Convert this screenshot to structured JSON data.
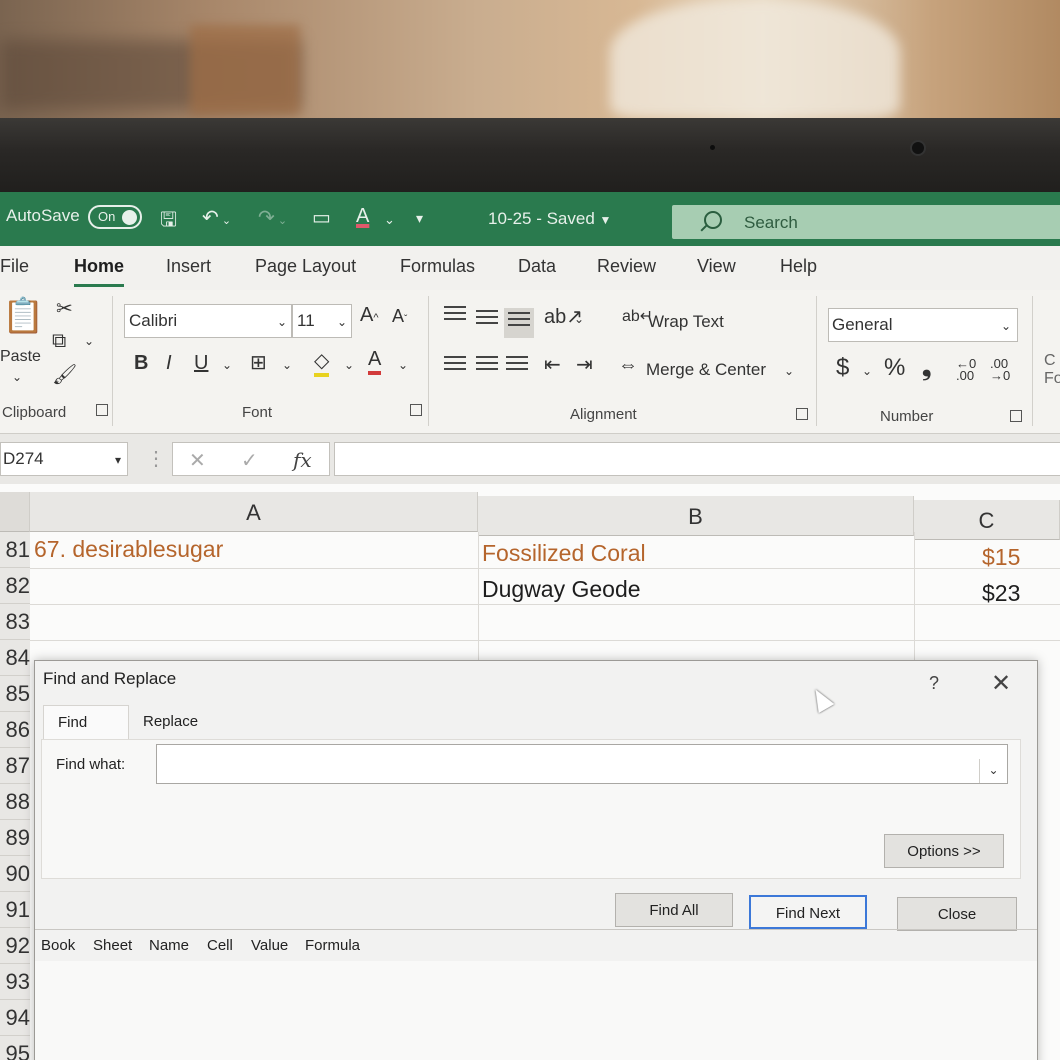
{
  "titlebar": {
    "autosave_label": "AutoSave",
    "autosave_state": "On",
    "doc_title": "10-25 - Saved",
    "search_placeholder": "Search"
  },
  "tabs": [
    "File",
    "Home",
    "Insert",
    "Page Layout",
    "Formulas",
    "Data",
    "Review",
    "View",
    "Help"
  ],
  "ribbon": {
    "paste_label": "Paste",
    "clipboard_label": "Clipboard",
    "font_name": "Calibri",
    "font_size": "11",
    "font_group_label": "Font",
    "bold": "B",
    "italic": "I",
    "underline": "U",
    "wrap_text": "Wrap Text",
    "merge_center": "Merge & Center",
    "alignment_label": "Alignment",
    "number_format": "General",
    "number_label": "Number",
    "currency_symbol": "$",
    "percent_symbol": "%",
    "comma_symbol": "❟"
  },
  "formula_bar": {
    "name_box": "D274",
    "fx": "fx"
  },
  "sheet": {
    "columns": [
      "A",
      "B",
      "C"
    ],
    "rows": [
      "81",
      "82",
      "83",
      "84",
      "85",
      "86",
      "87",
      "88",
      "89",
      "90",
      "91",
      "92",
      "93",
      "94",
      "95"
    ],
    "row81": {
      "a": "67. desirablesugar",
      "b": "Fossilized Coral",
      "c": "$15"
    },
    "row82": {
      "b": "Dugway Geode",
      "c": "$23"
    },
    "accent_color": "#b5652c"
  },
  "dialog": {
    "title": "Find and Replace",
    "help": "?",
    "tab_find": "Find",
    "tab_replace": "Replace",
    "find_what_label": "Find what:",
    "find_what_value": "",
    "options_button": "Options >>",
    "find_all_button": "Find All",
    "find_next_button": "Find Next",
    "close_button": "Close",
    "result_columns": [
      "Book",
      "Sheet",
      "Name",
      "Cell",
      "Value",
      "Formula"
    ]
  }
}
